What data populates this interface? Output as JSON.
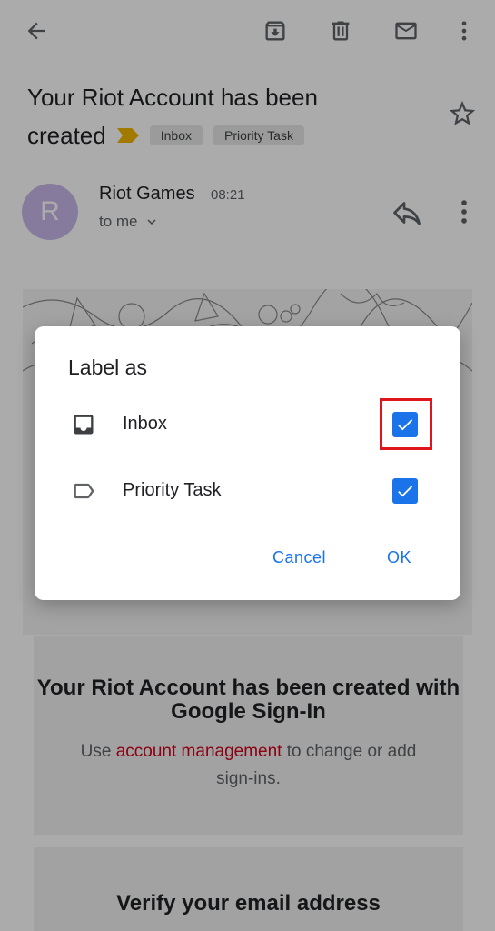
{
  "email": {
    "subject_line1": "Your Riot Account has been",
    "subject_line2": "created",
    "labels": [
      "Inbox",
      "Priority Task"
    ],
    "sender": {
      "avatar_letter": "R",
      "name": "Riot Games",
      "time": "08:21",
      "recipient": "to me"
    },
    "card": {
      "title": "Your Riot Account has been created with Google Sign-In",
      "body_prefix": "Use ",
      "body_link": "account management",
      "body_suffix": " to change or add sign-ins."
    },
    "card2_title": "Verify your email address"
  },
  "toolbar_icons": [
    "back-arrow-icon",
    "archive-icon",
    "delete-icon",
    "mark-unread-icon",
    "more-vert-icon"
  ],
  "dialog": {
    "title": "Label as",
    "options": [
      {
        "label": "Inbox",
        "icon": "inbox-icon",
        "checked": true
      },
      {
        "label": "Priority Task",
        "icon": "label-icon",
        "checked": true
      }
    ],
    "cancel": "Cancel",
    "ok": "OK"
  },
  "colors": {
    "accent": "#1a73e8",
    "avatar": "#c9b8ea",
    "importance_marker": "#f2b600",
    "highlight_box": "#e0151b",
    "link": "#d0021b"
  }
}
